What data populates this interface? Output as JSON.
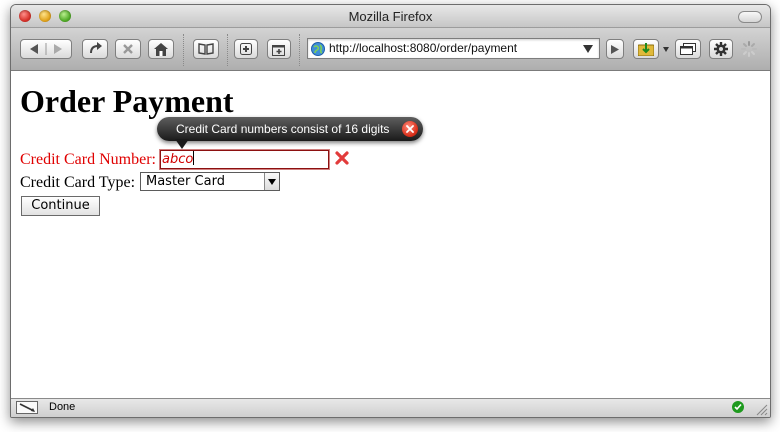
{
  "window": {
    "title": "Mozilla Firefox"
  },
  "toolbar": {
    "url": "http://localhost:8080/order/payment"
  },
  "page": {
    "heading": "Order Payment",
    "cc_number_label": "Credit Card Number:",
    "cc_number_value": "abco",
    "cc_type_label": "Credit Card Type:",
    "cc_type_selected": "Master Card",
    "continue_label": "Continue",
    "tooltip_message": "Credit Card numbers consist of 16 digits",
    "error_color": "#e00000"
  },
  "status": {
    "text": "Done"
  }
}
